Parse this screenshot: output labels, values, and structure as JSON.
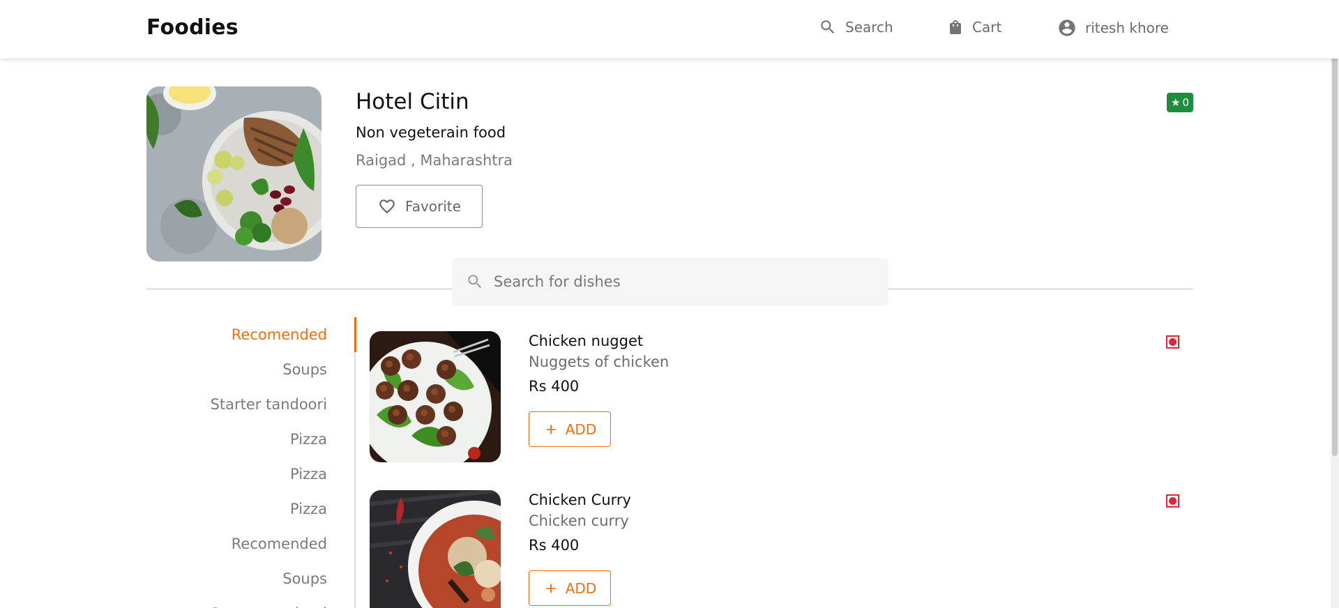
{
  "header": {
    "brand": "Foodies",
    "search_label": "Search",
    "cart_label": "Cart",
    "user_name": "ritesh khore"
  },
  "restaurant": {
    "name": "Hotel Citin",
    "cuisine": "Non vegeterain food",
    "location": "Raigad , Maharashtra",
    "favorite_label": "Favorite",
    "rating": "0"
  },
  "dish_search": {
    "placeholder": "Search for dishes"
  },
  "categories": [
    {
      "label": "Recomended",
      "active": true
    },
    {
      "label": "Soups"
    },
    {
      "label": "Starter tandoori"
    },
    {
      "label": "Pizza"
    },
    {
      "label": "Pizza"
    },
    {
      "label": "Pizza"
    },
    {
      "label": "Recomended"
    },
    {
      "label": "Soups"
    },
    {
      "label": "Starter tandoori"
    }
  ],
  "dishes": [
    {
      "name": "Chicken nugget",
      "description": "Nuggets of chicken",
      "price": "Rs 400",
      "add_label": "ADD"
    },
    {
      "name": "Chicken Curry",
      "description": "Chicken curry",
      "price": "Rs 400",
      "add_label": "ADD"
    }
  ],
  "colors": {
    "accent": "#f26f0e",
    "rating_bg": "#1e8e3e",
    "nonveg": "#e32636"
  }
}
